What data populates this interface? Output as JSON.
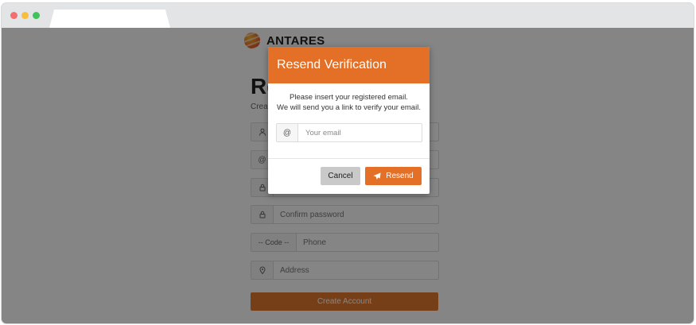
{
  "brand": {
    "name": "ANTARES"
  },
  "register": {
    "title": "Re",
    "subtitle": "Creat",
    "confirm_password_placeholder": "Confirm password",
    "code_label": "-- Code --",
    "phone_placeholder": "Phone",
    "address_placeholder": "Address",
    "create_button": "Create Account"
  },
  "modal": {
    "title": "Resend Verification",
    "line1": "Please insert your registered email.",
    "line2": "We will send you a link to verify your email.",
    "email_addon": "@",
    "email_placeholder": "Your email",
    "email_value": "",
    "cancel_label": "Cancel",
    "resend_label": "Resend"
  },
  "colors": {
    "accent": "#e37026",
    "overlay": "rgba(0,0,0,0.48)",
    "cancel": "#c9c9c9"
  },
  "icons": [
    "user-icon",
    "at-icon",
    "lock-icon",
    "map-pin-icon",
    "send-icon"
  ]
}
